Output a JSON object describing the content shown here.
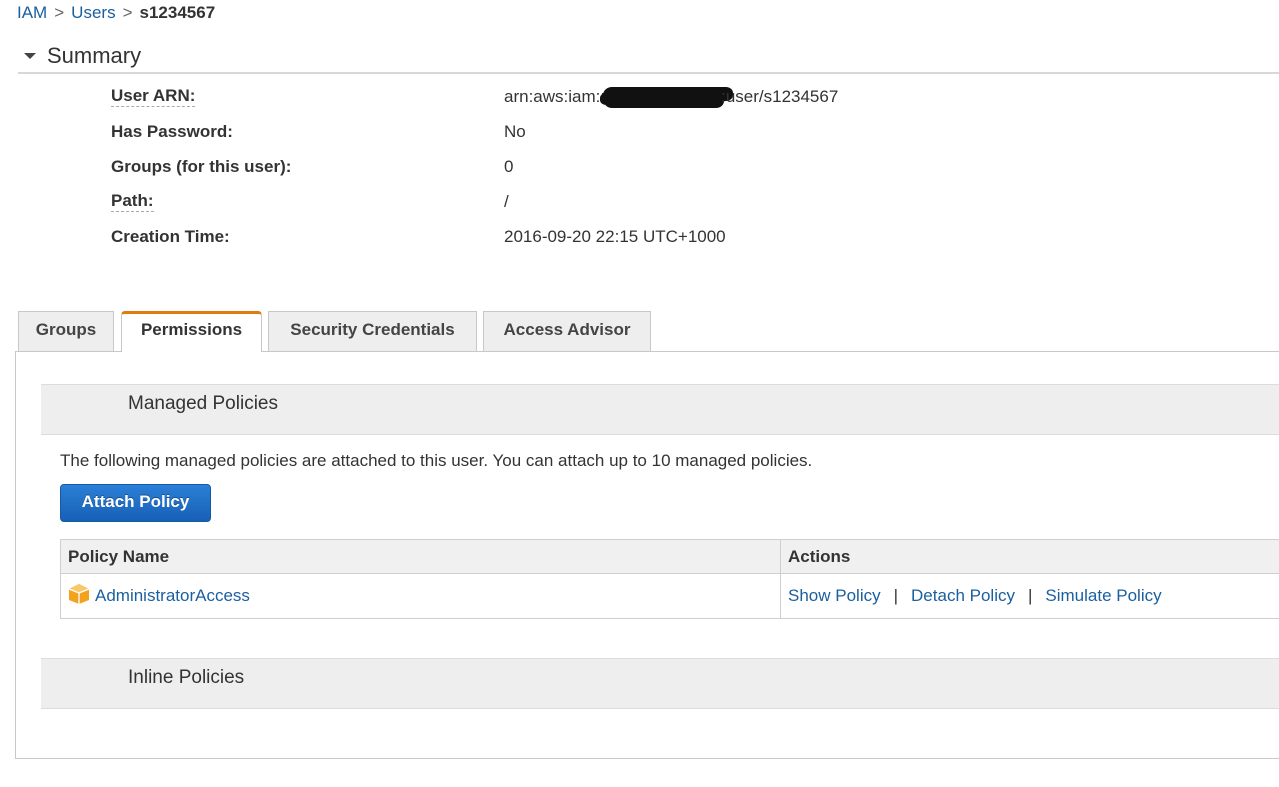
{
  "breadcrumb": {
    "items": [
      "IAM",
      "Users"
    ],
    "separator": ">",
    "current": "s1234567"
  },
  "summary": {
    "title": "Summary",
    "rows": [
      {
        "label": "User ARN:",
        "value_prefix": "arn:aws:iam::",
        "value_suffix": ":user/s1234567"
      },
      {
        "label": "Has Password:",
        "value": "No"
      },
      {
        "label": "Groups (for this user):",
        "value": "0"
      },
      {
        "label": "Path:",
        "value": "/"
      },
      {
        "label": "Creation Time:",
        "value": "2016-09-20 22:15 UTC+1000"
      }
    ]
  },
  "tabs": [
    {
      "label": "Groups",
      "active": false
    },
    {
      "label": "Permissions",
      "active": true
    },
    {
      "label": "Security Credentials",
      "active": false
    },
    {
      "label": "Access Advisor",
      "active": false
    }
  ],
  "managed_policies": {
    "title": "Managed Policies",
    "description": "The following managed policies are attached to this user. You can attach up to 10 managed policies.",
    "attach_button": "Attach Policy",
    "columns": [
      "Policy Name",
      "Actions"
    ],
    "rows": [
      {
        "name": "AdministratorAccess",
        "icon": "aws-managed-policy-icon",
        "actions": [
          "Show Policy",
          "Detach Policy",
          "Simulate Policy"
        ]
      }
    ],
    "action_separator": "|"
  },
  "inline_policies": {
    "title": "Inline Policies"
  },
  "colors": {
    "link": "#1a5f9e",
    "active_tab_accent": "#e07b10",
    "primary_button": "#1a6cc6",
    "policy_icon": "#f3a21b"
  }
}
